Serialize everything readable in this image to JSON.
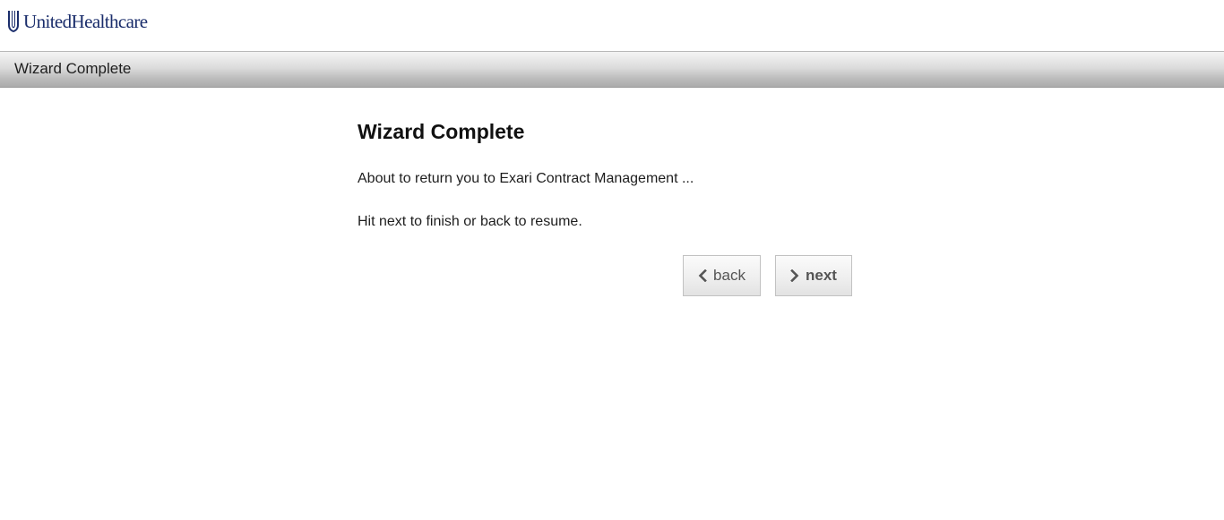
{
  "header": {
    "logo_text": "UnitedHealthcare",
    "brand_color": "#1a2d6b"
  },
  "titlebar": {
    "title": "Wizard Complete"
  },
  "main": {
    "heading": "Wizard Complete",
    "message": "About to return you to Exari Contract Management ...",
    "instruction": "Hit next to finish or back to resume."
  },
  "buttons": {
    "back_label": "back",
    "back_icon": "chevron-left-icon",
    "next_label": "next",
    "next_icon": "chevron-right-icon"
  }
}
